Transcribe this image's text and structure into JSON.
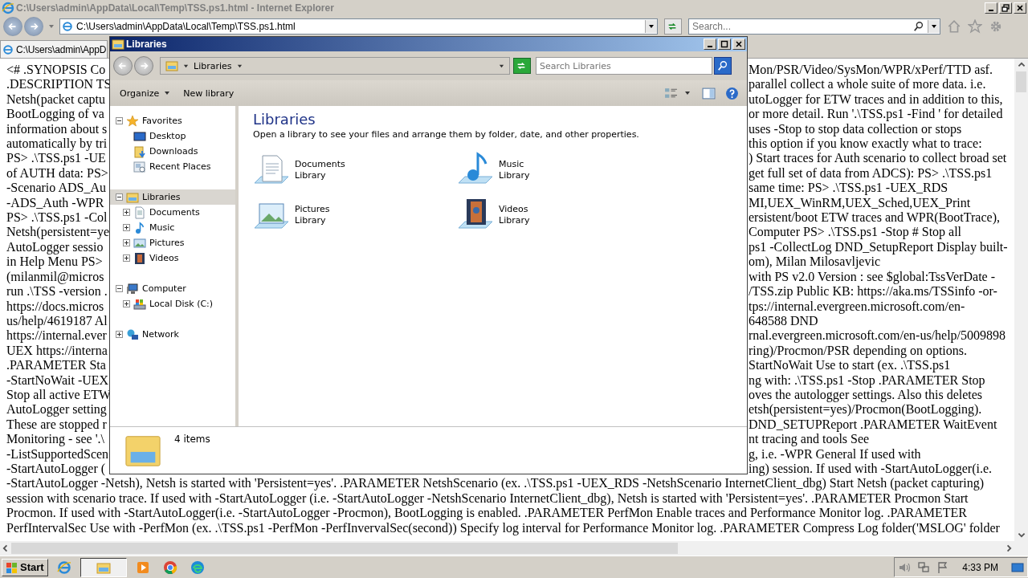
{
  "browser": {
    "title": "C:\\Users\\admin\\AppData\\Local\\Temp\\TSS.ps1.html - Internet Explorer",
    "address": "C:\\Users\\admin\\AppData\\Local\\Temp\\TSS.ps1.html",
    "search": {
      "placeholder": "Search..."
    },
    "tabs": [
      {
        "label": "C:\\Users\\admin\\AppD",
        "selected": true
      }
    ]
  },
  "page": {
    "split_lines": [
      {
        "left": "<# .SYNOPSIS Co",
        "right": "Mon/PSR/Video/SysMon/WPR/xPerf/TTD asf."
      },
      {
        "left": ".DESCRIPTION TS",
        "right": "parallel collect a whole suite of more data. i.e."
      },
      {
        "left": "Netsh(packet captu",
        "right": "utoLogger for ETW traces and in addition to this,"
      },
      {
        "left": "BootLogging of va",
        "right": "or more detail. Run '.\\TSS.ps1 -Find ' for detailed"
      },
      {
        "left": "information about s",
        "right": "uses -Stop to stop data collection or stops"
      },
      {
        "left": "automatically by tri",
        "right": "this option if you know exactly what to trace:"
      },
      {
        "left": "PS> .\\TSS.ps1 -UE",
        "right": ") Start traces for Auth scenario to collect broad set"
      },
      {
        "left": "of AUTH data: PS>",
        "right": "get full set of data from ADCS): PS> .\\TSS.ps1"
      },
      {
        "left": "-Scenario ADS_Au",
        "right": "same time: PS> .\\TSS.ps1 -UEX_RDS"
      },
      {
        "left": "-ADS_Auth -WPR",
        "right": "MI,UEX_WinRM,UEX_Sched,UEX_Print"
      },
      {
        "left": "PS> .\\TSS.ps1 -Col",
        "right": "ersistent/boot ETW traces and WPR(BootTrace),"
      },
      {
        "left": "Netsh(persistent=ye",
        "right": "Computer PS> .\\TSS.ps1 -Stop # Stop all"
      },
      {
        "left": "AutoLogger sessio",
        "right": "ps1 -CollectLog DND_SetupReport Display built-"
      },
      {
        "left": "in Help Menu PS>",
        "right": "om), Milan Milosavljevic"
      },
      {
        "left": "(milanmil@micros",
        "right": "with PS v2.0 Version : see $global:TssVerDate -"
      },
      {
        "left": "run .\\TSS -version .",
        "right": "/TSS.zip Public KB: https://aka.ms/TSSinfo -or-"
      },
      {
        "left": "https://docs.micros",
        "right": "tps://internal.evergreen.microsoft.com/en-"
      },
      {
        "left": "us/help/4619187 Al",
        "right": "648588 DND"
      },
      {
        "left": "https://internal.ever",
        "right": "rnal.evergreen.microsoft.com/en-us/help/5009898"
      },
      {
        "left": "UEX https://interna",
        "right": "ring)/Procmon/PSR depending on options."
      },
      {
        "left": ".PARAMETER Sta",
        "right": "StartNoWait Use to start (ex. .\\TSS.ps1"
      },
      {
        "left": "-StartNoWait -UEX",
        "right": "ng with: .\\TSS.ps1 -Stop .PARAMETER Stop"
      },
      {
        "left": "Stop all active ETW",
        "right": "oves the autologger settings. Also this deletes"
      },
      {
        "left": "AutoLogger setting",
        "right": "etsh(persistent=yes)/Procmon(BootLogging)."
      },
      {
        "left": "These are stopped r",
        "right": "DND_SETUPReport .PARAMETER WaitEvent"
      },
      {
        "left": "Monitoring - see '.\\",
        "right": "nt tracing and tools See"
      },
      {
        "left": "-ListSupportedScen",
        "right": "g, i.e. -WPR General If used with"
      },
      {
        "left": "-StartAutoLogger (",
        "right": "ing) session. If used with -StartAutoLogger(i.e."
      }
    ],
    "lines": [
      "-StartAutoLogger -Netsh), Netsh is started with 'Persistent=yes'. .PARAMETER NetshScenario (ex. .\\TSS.ps1 -UEX_RDS -NetshScenario InternetClient_dbg) Start Netsh (packet capturing)",
      "session with scenario trace. If used with -StartAutoLogger (i.e. -StartAutoLogger -NetshScenario InternetClient_dbg), Netsh is started with 'Persistent=yes'. .PARAMETER Procmon Start",
      "Procmon. If used with -StartAutoLogger(i.e. -StartAutoLogger -Procmon), BootLogging is enabled. .PARAMETER PerfMon Enable traces and Performance Monitor log. .PARAMETER",
      "PerfIntervalSec Use with -PerfMon (ex. .\\TSS.ps1 -PerfMon -PerfInvervalSec(second)) Specify log interval for Performance Monitor log. .PARAMETER Compress Log folder('MSLOG' folder"
    ]
  },
  "explorer": {
    "title": "Libraries",
    "breadcrumb": "Libraries",
    "search": {
      "placeholder": "Search Libraries"
    },
    "toolbar": [
      {
        "label": "Organize",
        "kind": "menu"
      },
      {
        "label": "New library",
        "kind": "plain"
      }
    ],
    "nav": [
      {
        "label": "Favorites",
        "kind": "star",
        "expanded": true,
        "selected": false,
        "children": [
          {
            "label": "Desktop",
            "kind": "desktop",
            "selected": false
          },
          {
            "label": "Downloads",
            "kind": "downloads",
            "selected": false
          },
          {
            "label": "Recent Places",
            "kind": "recent",
            "selected": false
          }
        ]
      },
      {
        "label": "Libraries",
        "kind": "libraries",
        "expanded": true,
        "selected": true,
        "children": [
          {
            "label": "Documents",
            "kind": "documents",
            "expanded": false,
            "selected": false
          },
          {
            "label": "Music",
            "kind": "music",
            "expanded": false,
            "selected": false
          },
          {
            "label": "Pictures",
            "kind": "pictures",
            "expanded": false,
            "selected": false
          },
          {
            "label": "Videos",
            "kind": "videos",
            "expanded": false,
            "selected": false
          }
        ]
      },
      {
        "label": "Computer",
        "kind": "computer",
        "expanded": true,
        "selected": false,
        "children": [
          {
            "label": "Local Disk (C:)",
            "kind": "disk",
            "expanded": false,
            "selected": false
          }
        ]
      },
      {
        "label": "Network",
        "kind": "network",
        "expanded": false,
        "selected": false
      }
    ],
    "heading": "Libraries",
    "description": "Open a library to see your files and arrange them by folder, date, and other properties.",
    "libraries": [
      {
        "name": "Documents",
        "type": "Library",
        "kind": "documents"
      },
      {
        "name": "Music",
        "type": "Library",
        "kind": "music"
      },
      {
        "name": "Pictures",
        "type": "Library",
        "kind": "pictures"
      },
      {
        "name": "Videos",
        "type": "Library",
        "kind": "videos"
      }
    ],
    "status": "4 items"
  },
  "taskbar": {
    "start": "Start",
    "apps": [
      {
        "kind": "ie",
        "selected": false
      },
      {
        "kind": "folder",
        "selected": true
      },
      {
        "kind": "media",
        "selected": false
      },
      {
        "kind": "chrome",
        "selected": false
      },
      {
        "kind": "edge",
        "selected": false
      }
    ],
    "clock": "4:33 PM"
  }
}
